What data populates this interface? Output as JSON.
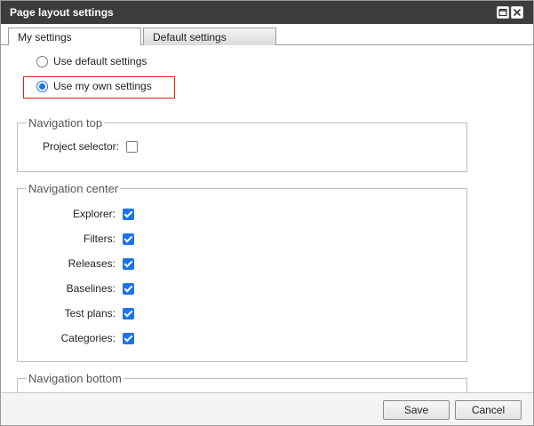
{
  "window": {
    "title": "Page layout settings",
    "maximize_icon": "maximize-icon",
    "close_icon": "close-icon"
  },
  "tabs": [
    {
      "label": "My settings",
      "active": true
    },
    {
      "label": "Default settings",
      "active": false
    }
  ],
  "mode": {
    "options": [
      {
        "label": "Use default settings",
        "checked": false
      },
      {
        "label": "Use my own settings",
        "checked": true
      }
    ],
    "highlight_color": "#e02020"
  },
  "navigation_top": {
    "legend": "Navigation top",
    "fields": [
      {
        "label": "Project selector:",
        "checked": false
      }
    ]
  },
  "navigation_center": {
    "legend": "Navigation center",
    "fields": [
      {
        "label": "Explorer:",
        "checked": true
      },
      {
        "label": "Filters:",
        "checked": true
      },
      {
        "label": "Releases:",
        "checked": true
      },
      {
        "label": "Baselines:",
        "checked": true
      },
      {
        "label": "Test plans:",
        "checked": true
      },
      {
        "label": "Categories:",
        "checked": true
      }
    ]
  },
  "navigation_bottom": {
    "legend": "Navigation bottom"
  },
  "footer": {
    "save_label": "Save",
    "cancel_label": "Cancel"
  },
  "colors": {
    "titlebar": "#3c3c3c",
    "accent": "#1a73e8"
  }
}
